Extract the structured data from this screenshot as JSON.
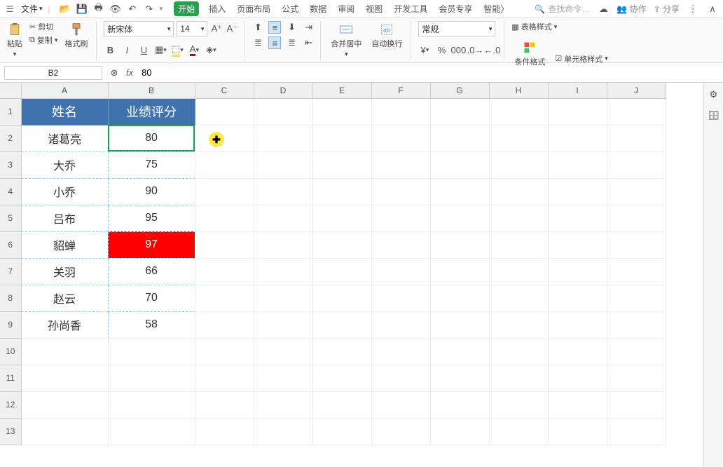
{
  "menu": {
    "file": "文件",
    "tabs": [
      "开始",
      "插入",
      "页面布局",
      "公式",
      "数据",
      "审阅",
      "视图",
      "开发工具",
      "会员专享",
      "智能〉"
    ],
    "active_tab": 0,
    "search_placeholder": "查找命令…",
    "collab": "协作",
    "share": "分享"
  },
  "ribbon": {
    "paste": "粘贴",
    "cut": "剪切",
    "copy": "复制",
    "format_painter": "格式刷",
    "font_name": "新宋体",
    "font_size": "14",
    "merge": "合并居中",
    "wrap": "自动换行",
    "number_format": "常规",
    "cond_format": "条件格式",
    "table_style": "表格样式",
    "cell_style": "单元格样式"
  },
  "namebox": "B2",
  "formula": "80",
  "columns": [
    "A",
    "B",
    "C",
    "D",
    "E",
    "F",
    "G",
    "H",
    "I",
    "J"
  ],
  "rows": [
    "1",
    "2",
    "3",
    "4",
    "5",
    "6",
    "7",
    "8",
    "9",
    "10",
    "11",
    "12",
    "13"
  ],
  "headers": {
    "A": "姓名",
    "B": "业绩评分"
  },
  "data": [
    {
      "name": "诸葛亮",
      "score": "80",
      "sel": true
    },
    {
      "name": "大乔",
      "score": "75"
    },
    {
      "name": "小乔",
      "score": "90"
    },
    {
      "name": "吕布",
      "score": "95"
    },
    {
      "name": "貂蝉",
      "score": "97",
      "hl": true
    },
    {
      "name": "关羽",
      "score": "66"
    },
    {
      "name": "赵云",
      "score": "70"
    },
    {
      "name": "孙尚香",
      "score": "58"
    }
  ]
}
